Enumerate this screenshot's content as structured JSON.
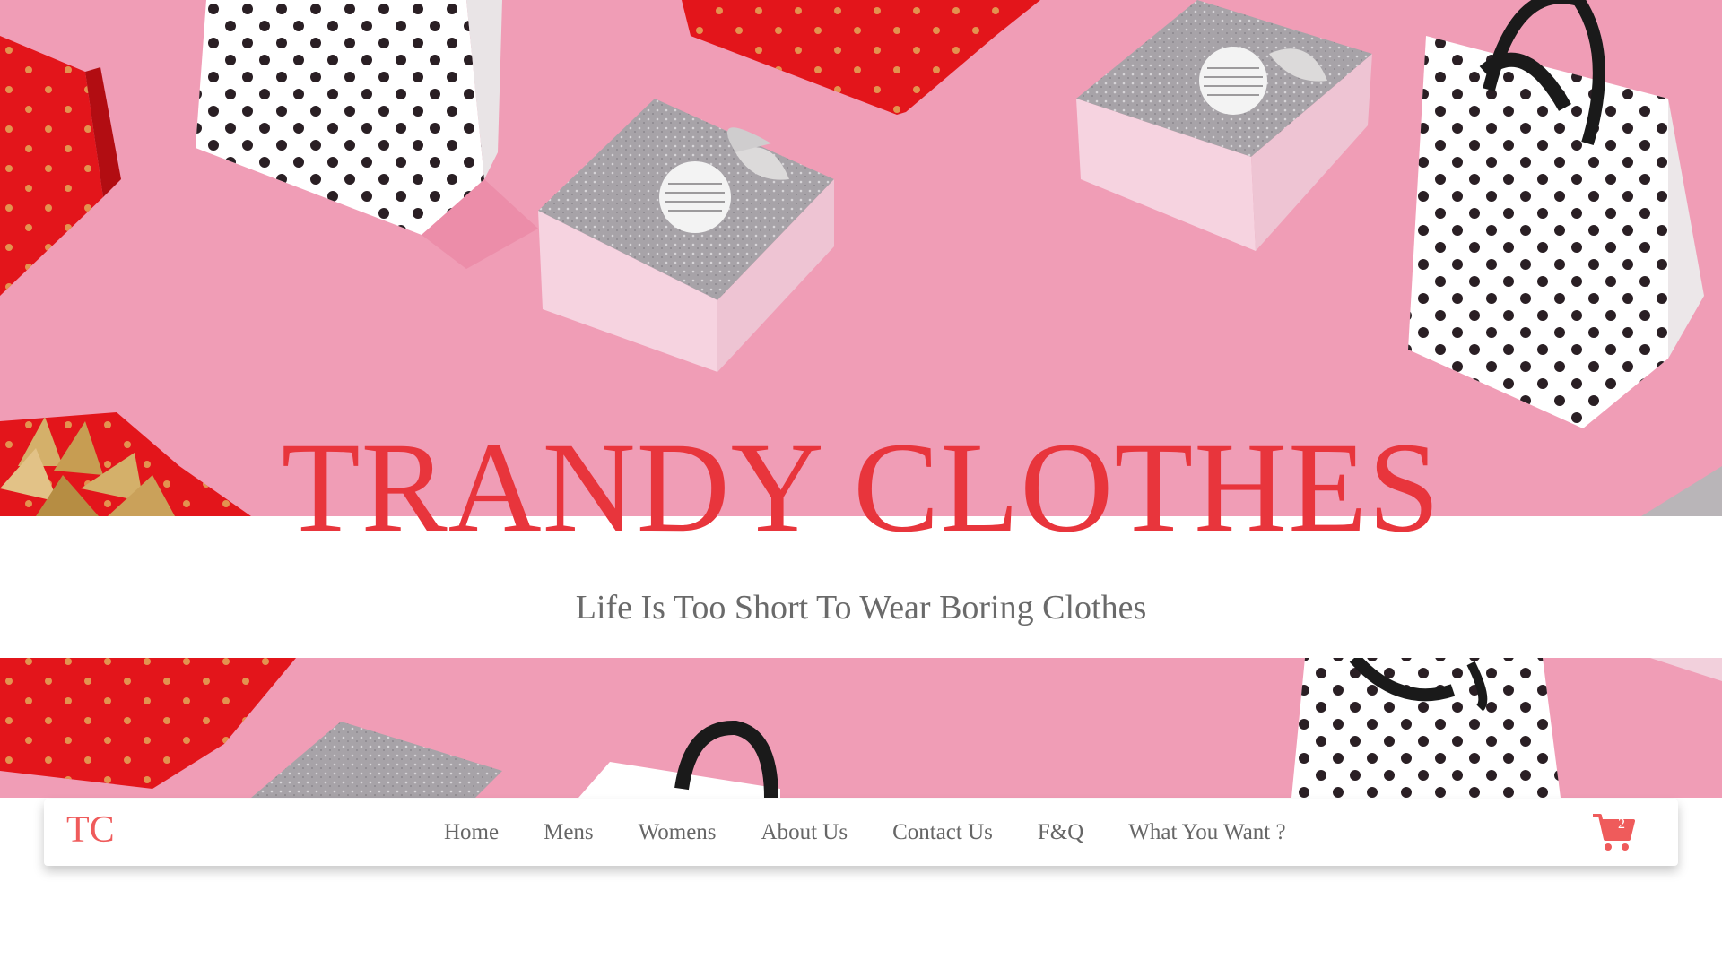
{
  "hero": {
    "title": "TRANDY CLOTHES",
    "subtitle": "Life Is Too Short To Wear Boring Clothes",
    "background_color": "#f09db6",
    "title_color": "#e8353c"
  },
  "navbar": {
    "logo": "TC",
    "logo_color": "#ef5b5b",
    "links": [
      "Home",
      "Mens",
      "Womens",
      "About Us",
      "Contact Us",
      "F&Q",
      "What You Want ?"
    ],
    "cart": {
      "icon": "shopping-cart-icon",
      "count": "2",
      "color": "#ef5b5b"
    }
  }
}
